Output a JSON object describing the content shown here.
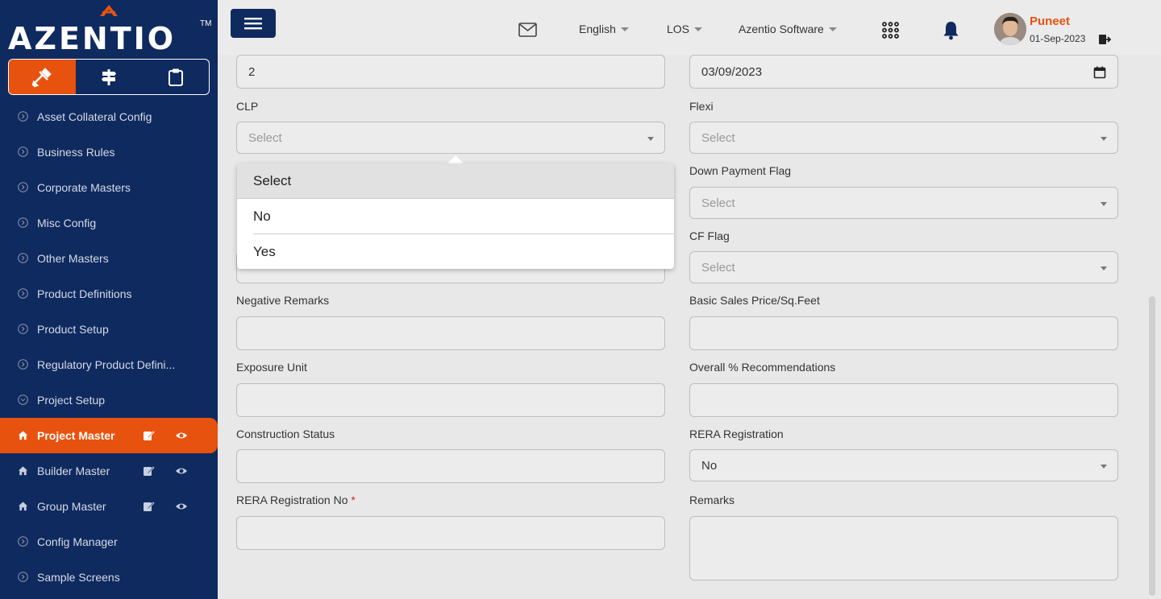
{
  "brand": {
    "name": "AZENTIO",
    "tm": "TM"
  },
  "sidebar": {
    "items": [
      {
        "label": "Asset Collateral Config"
      },
      {
        "label": "Business Rules"
      },
      {
        "label": "Corporate Masters"
      },
      {
        "label": "Misc Config"
      },
      {
        "label": "Other Masters"
      },
      {
        "label": "Product Definitions"
      },
      {
        "label": "Product Setup"
      },
      {
        "label": "Regulatory Product Defini..."
      },
      {
        "label": "Project Setup"
      },
      {
        "label": "Project Master"
      },
      {
        "label": "Builder Master"
      },
      {
        "label": "Group Master"
      },
      {
        "label": "Config Manager"
      },
      {
        "label": "Sample Screens"
      }
    ]
  },
  "header": {
    "language": "English",
    "module": "LOS",
    "company": "Azentio Software",
    "user": {
      "name": "Puneet",
      "date": "01-Sep-2023"
    }
  },
  "form": {
    "top_left_value": "2",
    "top_right_value": "03/09/2023",
    "clp": {
      "label": "CLP",
      "value": "Select"
    },
    "flexi": {
      "label": "Flexi",
      "value": "Select"
    },
    "down_payment_flag": {
      "label": "Down Payment Flag",
      "value": "Select"
    },
    "cf_flag": {
      "label": "CF Flag",
      "value": "Select"
    },
    "negative_remarks": {
      "label": "Negative Remarks",
      "value": ""
    },
    "basic_sales_price": {
      "label": "Basic Sales Price/Sq.Feet",
      "value": ""
    },
    "exposure_unit": {
      "label": "Exposure Unit",
      "value": ""
    },
    "overall_recommendations": {
      "label": "Overall % Recommendations",
      "value": ""
    },
    "construction_status": {
      "label": "Construction Status",
      "value": ""
    },
    "rera_registration": {
      "label": "RERA Registration",
      "value": "No"
    },
    "rera_registration_no": {
      "label": "RERA Registration No",
      "required": "*",
      "value": ""
    },
    "remarks": {
      "label": "Remarks",
      "value": ""
    }
  },
  "dropdown": {
    "options": [
      "Select",
      "No",
      "Yes"
    ],
    "highlighted": "Select"
  },
  "colors": {
    "accent": "#e8520f",
    "sidebar": "#0f2a5e"
  }
}
